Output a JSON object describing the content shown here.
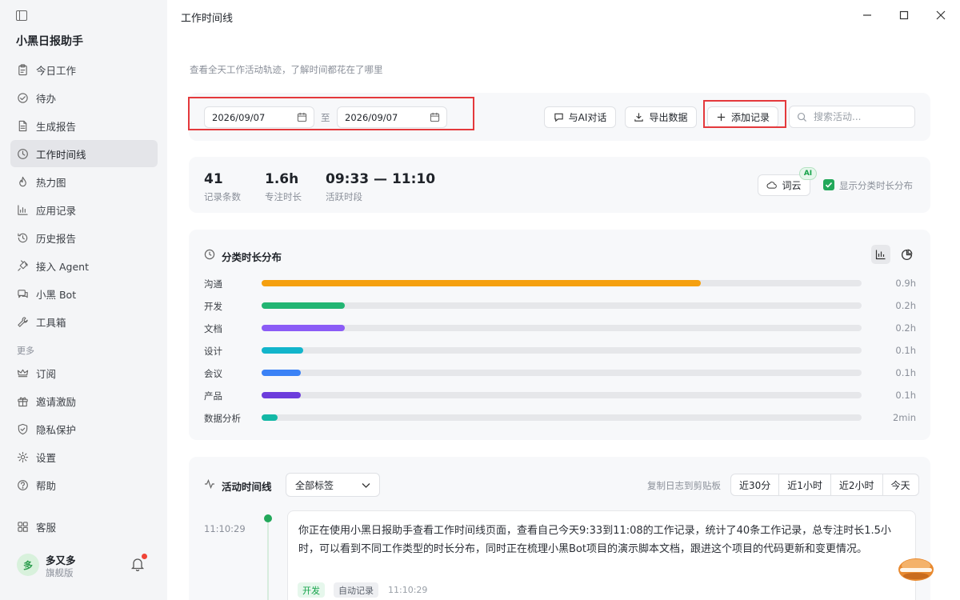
{
  "app": {
    "name": "小黑日报助手"
  },
  "sidebar": {
    "items": [
      {
        "label": "今日工作",
        "icon": "clipboard-icon"
      },
      {
        "label": "待办",
        "icon": "check-circle-icon"
      },
      {
        "label": "生成报告",
        "icon": "document-icon"
      },
      {
        "label": "工作时间线",
        "icon": "clock-icon",
        "active": true
      },
      {
        "label": "热力图",
        "icon": "flame-icon"
      },
      {
        "label": "应用记录",
        "icon": "bar-chart-icon"
      },
      {
        "label": "历史报告",
        "icon": "history-icon"
      },
      {
        "label": "接入 Agent",
        "icon": "plug-icon"
      },
      {
        "label": "小黑 Bot",
        "icon": "chat-bot-icon"
      },
      {
        "label": "工具箱",
        "icon": "wrench-icon"
      }
    ],
    "section_label": "更多",
    "more_items": [
      {
        "label": "订阅",
        "icon": "crown-icon"
      },
      {
        "label": "邀请激励",
        "icon": "gift-icon"
      },
      {
        "label": "隐私保护",
        "icon": "shield-icon"
      },
      {
        "label": "设置",
        "icon": "gear-icon"
      },
      {
        "label": "帮助",
        "icon": "help-icon"
      }
    ],
    "support": {
      "label": "客服",
      "icon": "support-icon"
    },
    "user": {
      "avatar_text": "多",
      "name": "多又多",
      "plan": "旗舰版"
    }
  },
  "window": {
    "title": "工作时间线"
  },
  "page": {
    "subtitle": "查看全天工作活动轨迹，了解时间都花在了哪里"
  },
  "toolbar": {
    "date_start": "2026/09/07",
    "date_sep": "至",
    "date_end": "2026/09/07",
    "ai_chat_label": "与AI对话",
    "export_label": "导出数据",
    "add_label": "添加记录",
    "search_placeholder": "搜索活动..."
  },
  "stats": {
    "records": {
      "value": "41",
      "label": "记录条数"
    },
    "focus": {
      "value": "1.6h",
      "label": "专注时长"
    },
    "active": {
      "value": "09:33 — 11:10",
      "label": "活跃时段"
    },
    "wordcloud_label": "词云",
    "ai_badge": "AI",
    "show_dist_label": "显示分类时长分布",
    "show_dist_checked": true
  },
  "distribution": {
    "title": "分类时长分布",
    "categories": [
      {
        "name": "沟通",
        "hours": 0.9,
        "value_label": "0.9h",
        "color": "#f5a00f"
      },
      {
        "name": "开发",
        "hours": 0.17,
        "value_label": "0.2h",
        "color": "#22b573"
      },
      {
        "name": "文档",
        "hours": 0.17,
        "value_label": "0.2h",
        "color": "#8b5cf6"
      },
      {
        "name": "设计",
        "hours": 0.085,
        "value_label": "0.1h",
        "color": "#12b5cb"
      },
      {
        "name": "会议",
        "hours": 0.08,
        "value_label": "0.1h",
        "color": "#3b82f6"
      },
      {
        "name": "产品",
        "hours": 0.08,
        "value_label": "0.1h",
        "color": "#6d3ddc"
      },
      {
        "name": "数据分析",
        "hours": 0.033,
        "value_label": "2min",
        "color": "#14b8a6"
      }
    ],
    "scale_max_hours": 1.23
  },
  "timeline": {
    "title": "活动时间线",
    "filter_value": "全部标签",
    "copy_label": "复制日志到剪贴板",
    "ranges": [
      "近30分",
      "近1小时",
      "近2小时",
      "今天"
    ],
    "entries": [
      {
        "time": "11:10:29",
        "text": "你正在使用小黑日报助手查看工作时间线页面，查看自己今天9:33到11:08的工作记录，统计了40条工作记录，总专注时长1.5小时，可以看到不同工作类型的时长分布，同时正在梳理小黑Bot项目的演示脚本文档，跟进这个项目的代码更新和变更情况。",
        "tags": [
          "开发",
          "自动记录"
        ],
        "tag_time": "11:10:29"
      }
    ]
  }
}
